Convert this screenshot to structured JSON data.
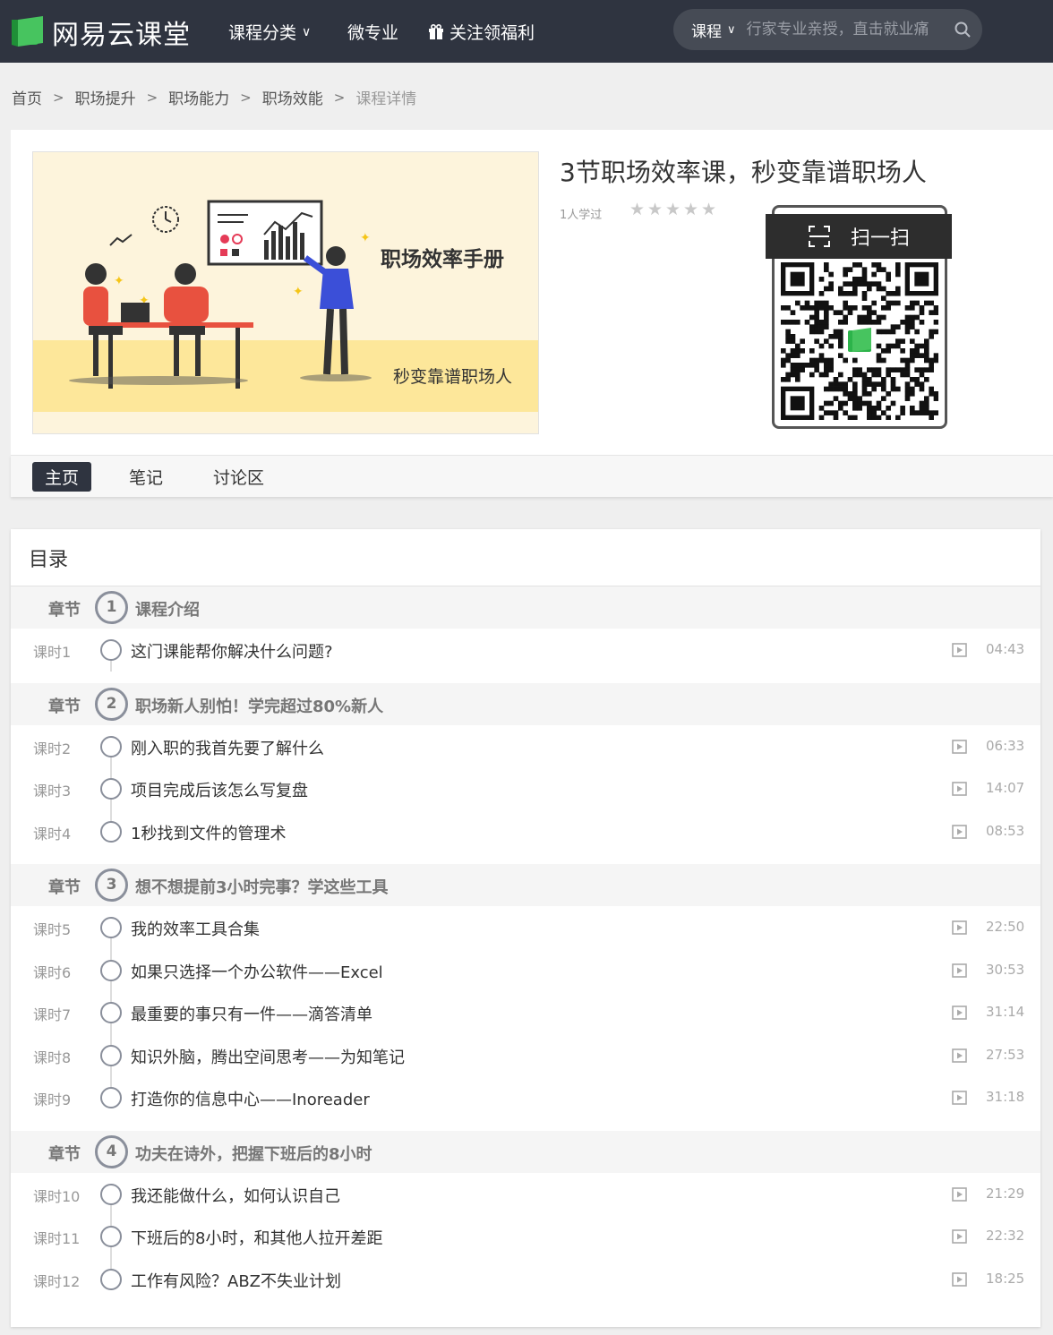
{
  "header": {
    "logo_text": "网易云课堂",
    "nav": [
      {
        "label": "课程分类",
        "has_caret": true
      },
      {
        "label": "微专业",
        "has_caret": false
      },
      {
        "label": "关注领福利",
        "icon": "gift-icon"
      }
    ],
    "search": {
      "scope": "课程",
      "placeholder": "行家专业亲授，直击就业痛"
    }
  },
  "breadcrumb": [
    "首页",
    "职场提升",
    "职场能力",
    "职场效能",
    "课程详情"
  ],
  "course": {
    "title": "3节职场效率课，秒变靠谱职场人",
    "learners": "1人学过",
    "rating_stars": 0,
    "banner_title": "职场效率手册",
    "banner_subtitle": "秒变靠谱职场人",
    "qr_label": "扫一扫"
  },
  "tabs": [
    {
      "label": "主页",
      "active": true
    },
    {
      "label": "笔记",
      "active": false
    },
    {
      "label": "讨论区",
      "active": false
    }
  ],
  "catalog": {
    "title": "目录",
    "chapter_label": "章节",
    "chapters": [
      {
        "num": "1",
        "title": "课程介绍",
        "lessons": [
          {
            "label": "课时1",
            "title": "这门课能帮你解决什么问题?",
            "duration": "04:43"
          }
        ]
      },
      {
        "num": "2",
        "title": "职场新人别怕！学完超过80%新人",
        "lessons": [
          {
            "label": "课时2",
            "title": "刚入职的我首先要了解什么",
            "duration": "06:33"
          },
          {
            "label": "课时3",
            "title": "项目完成后该怎么写复盘",
            "duration": "14:07"
          },
          {
            "label": "课时4",
            "title": "1秒找到文件的管理术",
            "duration": "08:53"
          }
        ]
      },
      {
        "num": "3",
        "title": "想不想提前3小时完事？学这些工具",
        "lessons": [
          {
            "label": "课时5",
            "title": "我的效率工具合集",
            "duration": "22:50"
          },
          {
            "label": "课时6",
            "title": "如果只选择一个办公软件——Excel",
            "duration": "30:53"
          },
          {
            "label": "课时7",
            "title": "最重要的事只有一件——滴答清单",
            "duration": "31:14"
          },
          {
            "label": "课时8",
            "title": "知识外脑，腾出空间思考——为知笔记",
            "duration": "27:53"
          },
          {
            "label": "课时9",
            "title": "打造你的信息中心——Inoreader",
            "duration": "31:18"
          }
        ]
      },
      {
        "num": "4",
        "title": "功夫在诗外，把握下班后的8小时",
        "lessons": [
          {
            "label": "课时10",
            "title": "我还能做什么，如何认识自己",
            "duration": "21:29"
          },
          {
            "label": "课时11",
            "title": "下班后的8小时，和其他人拉开差距",
            "duration": "22:32"
          },
          {
            "label": "课时12",
            "title": "工作有风险？ABZ不失业计划",
            "duration": "18:25"
          }
        ]
      }
    ]
  },
  "colors": {
    "header_bg": "#2f3440",
    "brand_green": "#2cb34a",
    "banner_yellow": "#fde79a"
  }
}
